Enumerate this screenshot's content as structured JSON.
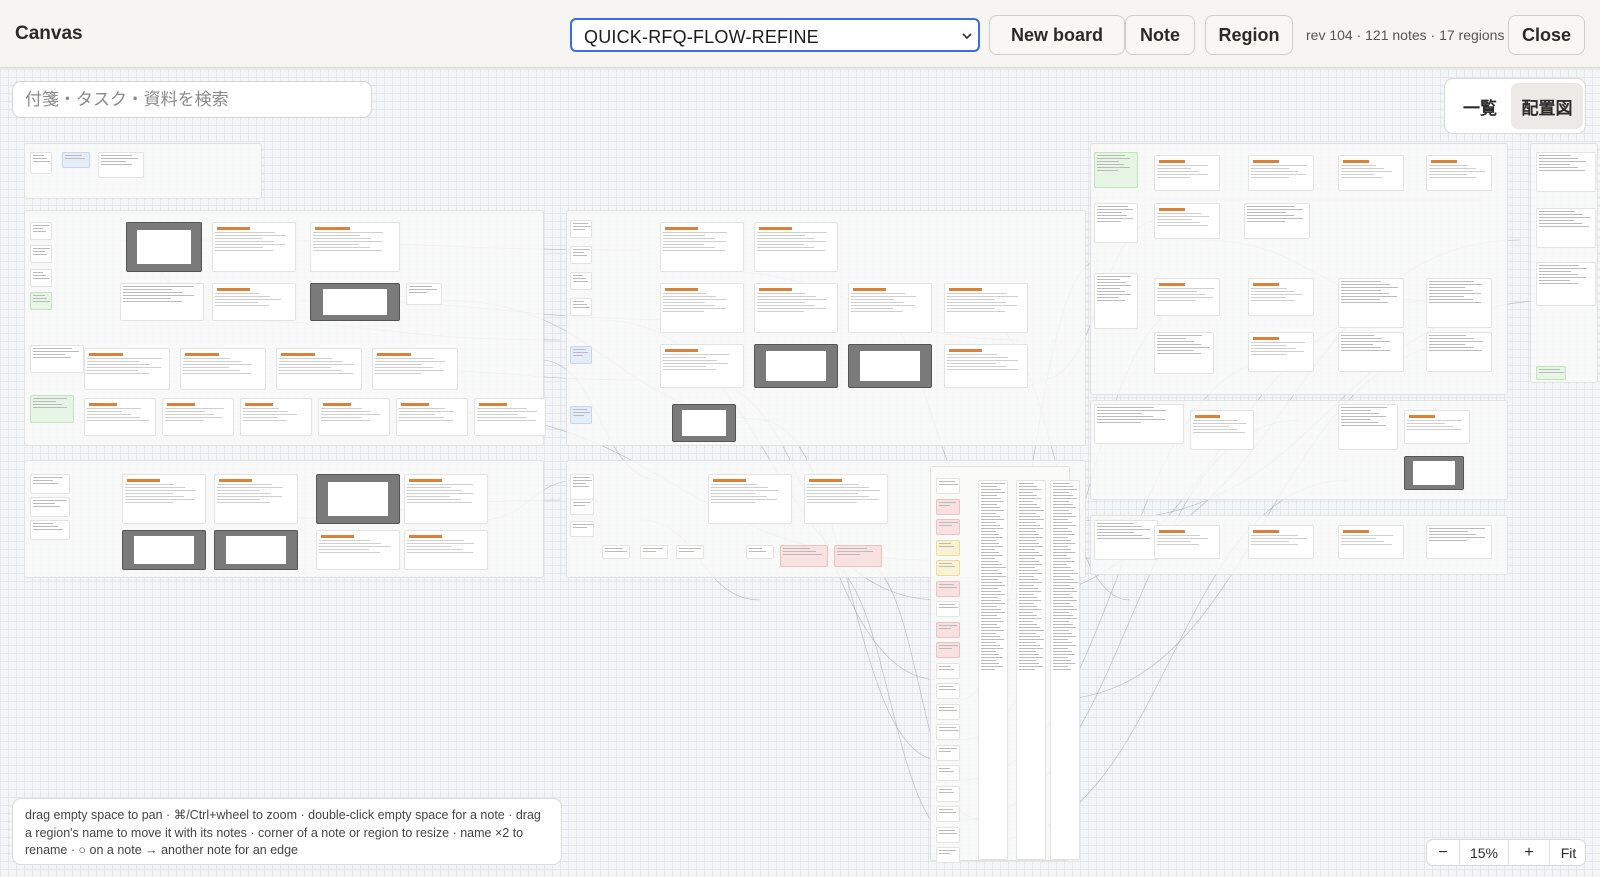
{
  "app": {
    "title": "Canvas"
  },
  "toolbar": {
    "board_selected": "QUICK-RFQ-FLOW-REFINE",
    "new_board_label": "New board",
    "note_label": "Note",
    "region_label": "Region",
    "meta": "rev 104 · 121 notes · 17 regions",
    "close_label": "Close"
  },
  "search": {
    "placeholder": "付箋・タスク・資料を検索",
    "value": ""
  },
  "view_toggle": {
    "list_label": "一覧",
    "map_label": "配置図",
    "active": "map"
  },
  "help": {
    "text": "drag empty space to pan · ⌘/Ctrl+wheel to zoom · double-click empty space for a note · drag a region's name to move it with its notes · corner of a note or region to resize · name ×2 to rename · ○ on a note → another note for an edge"
  },
  "zoom": {
    "out_label": "−",
    "level": "15%",
    "in_label": "+",
    "fit_label": "Fit"
  },
  "colors": {
    "accent": "#3a6fd8",
    "note_green": "#e7f5e4",
    "note_blue": "#e5edf9",
    "note_pink": "#f9e1e1",
    "note_yellow": "#faf3d3",
    "screenshot_header": "#d9823b"
  },
  "icons": {
    "select_chevron": "chevron-down-icon"
  }
}
